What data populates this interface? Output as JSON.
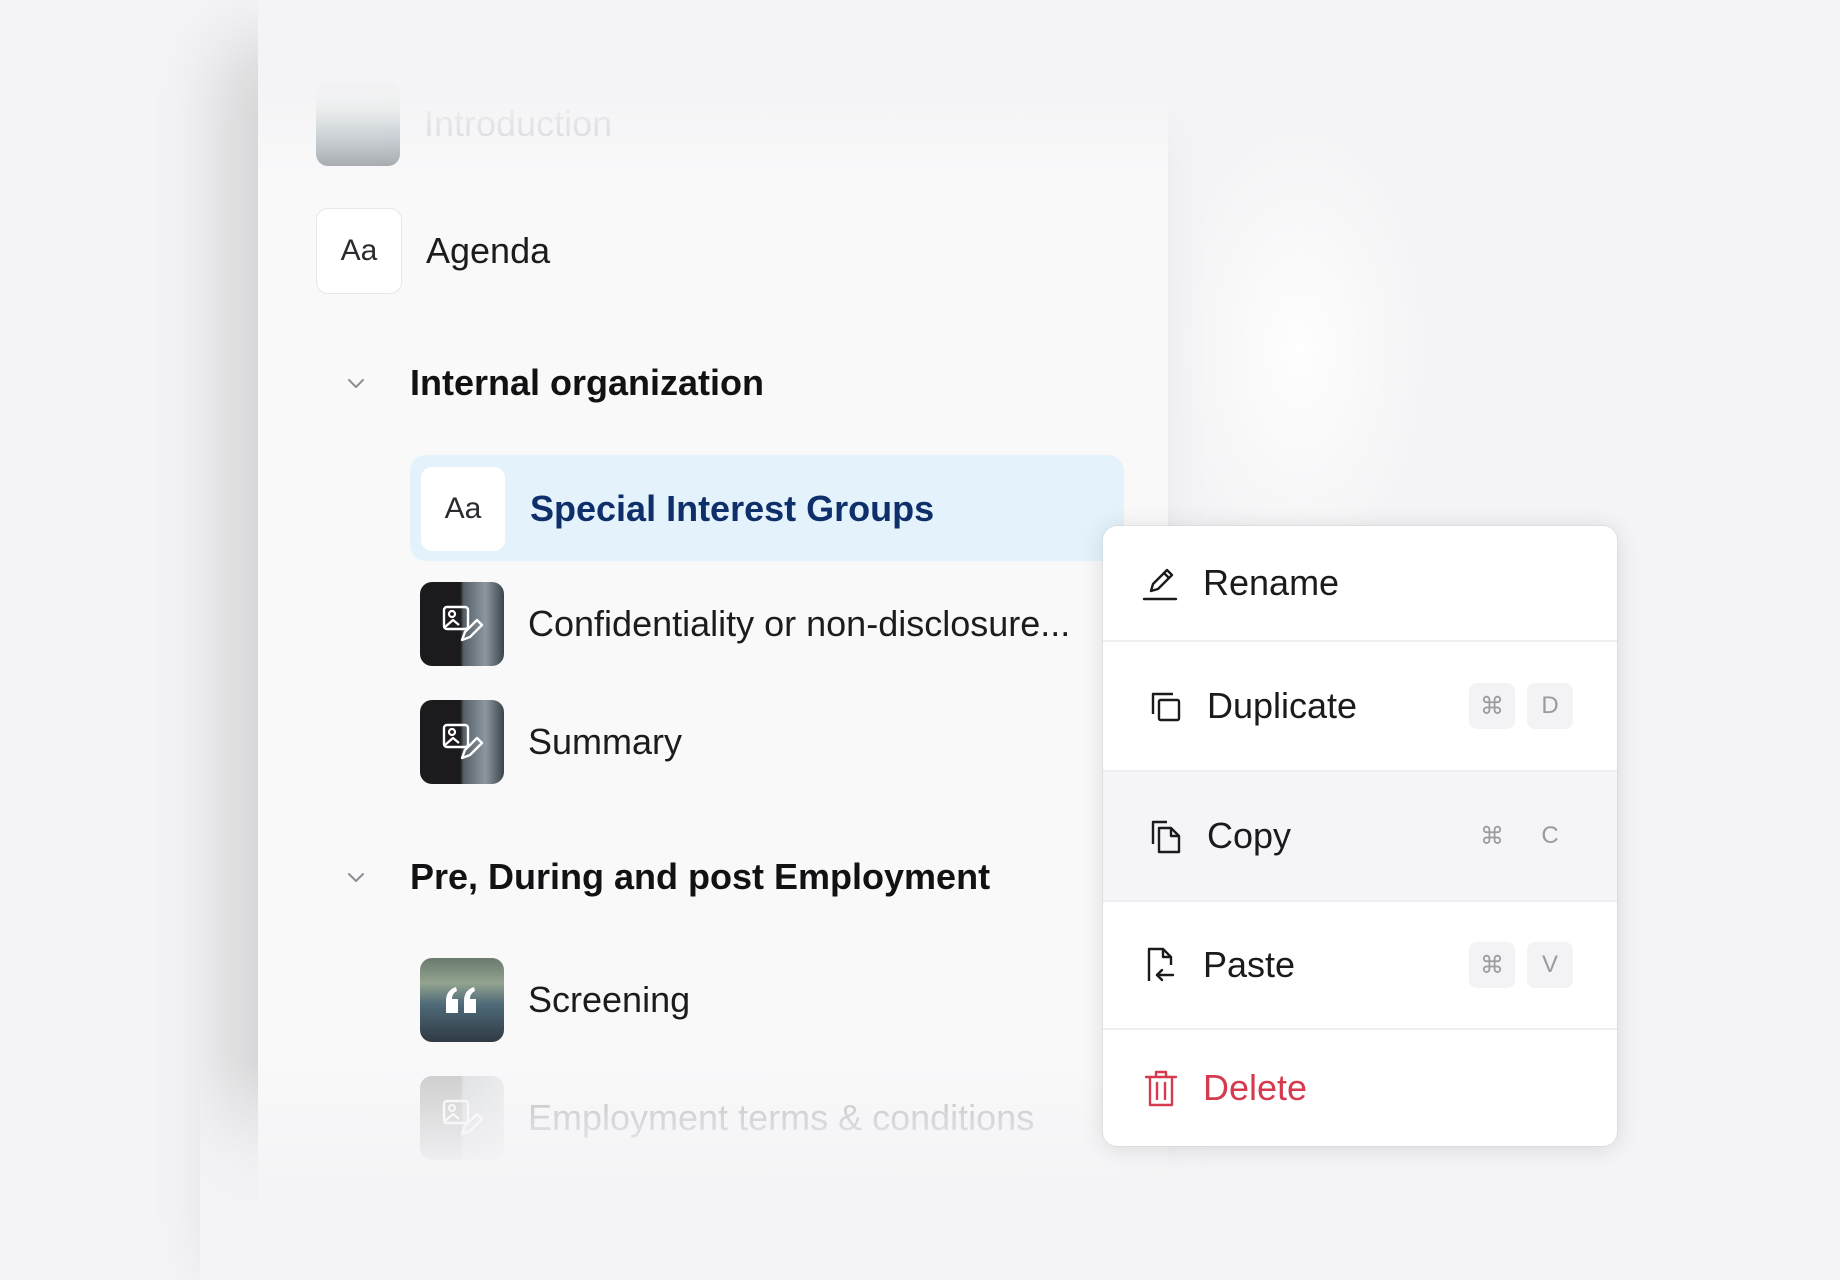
{
  "outline": {
    "intro": {
      "label": "Introduction"
    },
    "agenda": {
      "label": "Agenda",
      "thumb": "Aa"
    },
    "sections": [
      {
        "title": "Internal organization",
        "items": [
          {
            "label": "Special Interest Groups",
            "thumb": "Aa",
            "selected": true
          },
          {
            "label": "Confidentiality or non-disclosure...",
            "icon": "image-edit-icon"
          },
          {
            "label": "Summary",
            "icon": "image-edit-icon"
          }
        ]
      },
      {
        "title": "Pre, During and post Employment",
        "items": [
          {
            "label": "Screening",
            "icon": "quote-icon"
          },
          {
            "label": "Employment terms & conditions",
            "icon": "image-edit-icon"
          }
        ]
      }
    ]
  },
  "menu": {
    "items": [
      {
        "label": "Rename",
        "icon": "pencil-icon"
      },
      {
        "label": "Duplicate",
        "icon": "duplicate-icon",
        "keys": [
          "⌘",
          "D"
        ]
      },
      {
        "label": "Copy",
        "icon": "copy-icon",
        "keys": [
          "⌘",
          "C"
        ]
      },
      {
        "label": "Paste",
        "icon": "paste-icon",
        "keys": [
          "⌘",
          "V"
        ]
      },
      {
        "label": "Delete",
        "icon": "trash-icon"
      }
    ]
  },
  "colors": {
    "selected_bg": "#e4f3fb",
    "selected_text": "#0f2f6b",
    "danger": "#d53a4e"
  }
}
